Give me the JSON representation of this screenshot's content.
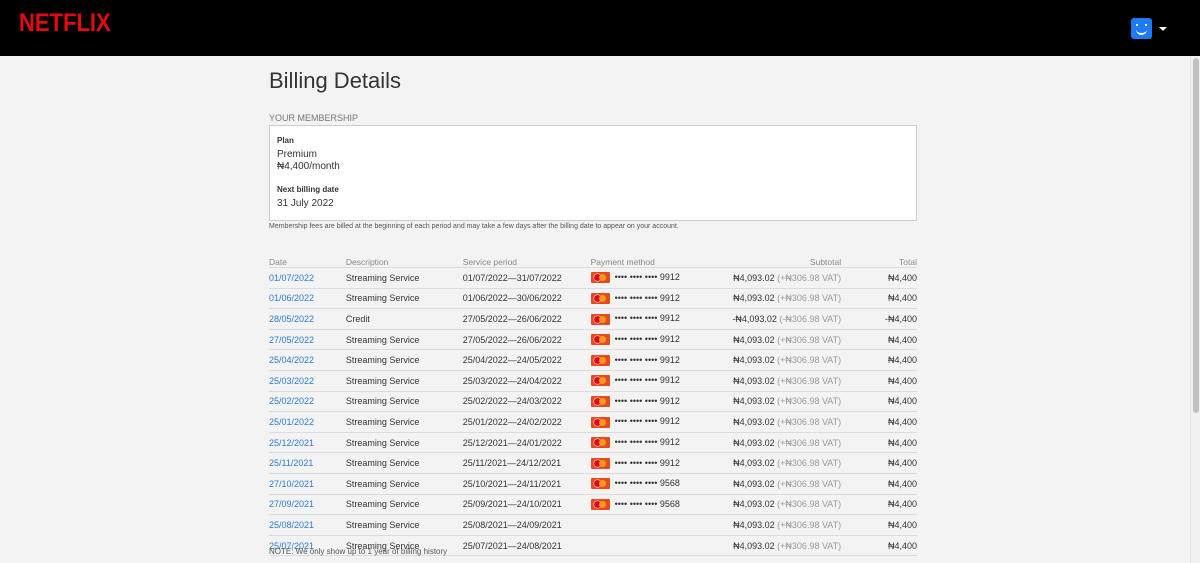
{
  "brand": {
    "logo_text": "NETFLIX",
    "logo_color": "#e50914"
  },
  "header": {
    "profile_icon": "smiley-profile-icon",
    "dropdown_icon": "caret-down-icon"
  },
  "page": {
    "title": "Billing Details"
  },
  "membership": {
    "heading": "YOUR MEMBERSHIP",
    "plan_label": "Plan",
    "plan_name": "Premium",
    "plan_price": "₦4,400/month",
    "next_billing_label": "Next billing date",
    "next_billing_date": "31 July 2022"
  },
  "fees_note": "Membership fees are billed at the beginning of each period and may take a few days after the billing date to appear on your account.",
  "table": {
    "headers": [
      "Date",
      "Description",
      "Service period",
      "Payment method",
      "Subtotal",
      "Total"
    ],
    "rows": [
      {
        "date": "01/07/2022",
        "description": "Streaming Service",
        "period": "01/07/2022—31/07/2022",
        "card": "•••• •••• •••• 9912",
        "subtotal": "₦4,093.02",
        "vat": "(+₦306.98 VAT)",
        "total": "₦4,400"
      },
      {
        "date": "01/06/2022",
        "description": "Streaming Service",
        "period": "01/06/2022—30/06/2022",
        "card": "•••• •••• •••• 9912",
        "subtotal": "₦4,093.02",
        "vat": "(+₦306.98 VAT)",
        "total": "₦4,400"
      },
      {
        "date": "28/05/2022",
        "description": "Credit",
        "period": "27/05/2022—26/06/2022",
        "card": "•••• •••• •••• 9912",
        "subtotal": "-₦4,093.02",
        "vat": "(-₦306.98 VAT)",
        "total": "-₦4,400"
      },
      {
        "date": "27/05/2022",
        "description": "Streaming Service",
        "period": "27/05/2022—26/06/2022",
        "card": "•••• •••• •••• 9912",
        "subtotal": "₦4,093.02",
        "vat": "(+₦306.98 VAT)",
        "total": "₦4,400"
      },
      {
        "date": "25/04/2022",
        "description": "Streaming Service",
        "period": "25/04/2022—24/05/2022",
        "card": "•••• •••• •••• 9912",
        "subtotal": "₦4,093.02",
        "vat": "(+₦306.98 VAT)",
        "total": "₦4,400"
      },
      {
        "date": "25/03/2022",
        "description": "Streaming Service",
        "period": "25/03/2022—24/04/2022",
        "card": "•••• •••• •••• 9912",
        "subtotal": "₦4,093.02",
        "vat": "(+₦306.98 VAT)",
        "total": "₦4,400"
      },
      {
        "date": "25/02/2022",
        "description": "Streaming Service",
        "period": "25/02/2022—24/03/2022",
        "card": "•••• •••• •••• 9912",
        "subtotal": "₦4,093.02",
        "vat": "(+₦306.98 VAT)",
        "total": "₦4,400"
      },
      {
        "date": "25/01/2022",
        "description": "Streaming Service",
        "period": "25/01/2022—24/02/2022",
        "card": "•••• •••• •••• 9912",
        "subtotal": "₦4,093.02",
        "vat": "(+₦306.98 VAT)",
        "total": "₦4,400"
      },
      {
        "date": "25/12/2021",
        "description": "Streaming Service",
        "period": "25/12/2021—24/01/2022",
        "card": "•••• •••• •••• 9912",
        "subtotal": "₦4,093.02",
        "vat": "(+₦306.98 VAT)",
        "total": "₦4,400"
      },
      {
        "date": "25/11/2021",
        "description": "Streaming Service",
        "period": "25/11/2021—24/12/2021",
        "card": "•••• •••• •••• 9912",
        "subtotal": "₦4,093.02",
        "vat": "(+₦306.98 VAT)",
        "total": "₦4,400"
      },
      {
        "date": "27/10/2021",
        "description": "Streaming Service",
        "period": "25/10/2021—24/11/2021",
        "card": "•••• •••• •••• 9568",
        "subtotal": "₦4,093.02",
        "vat": "(+₦306.98 VAT)",
        "total": "₦4,400"
      },
      {
        "date": "27/09/2021",
        "description": "Streaming Service",
        "period": "25/09/2021—24/10/2021",
        "card": "•••• •••• •••• 9568",
        "subtotal": "₦4,093.02",
        "vat": "(+₦306.98 VAT)",
        "total": "₦4,400"
      },
      {
        "date": "25/08/2021",
        "description": "Streaming Service",
        "period": "25/08/2021—24/09/2021",
        "card": "",
        "subtotal": "₦4,093.02",
        "vat": "(+₦306.98 VAT)",
        "total": "₦4,400"
      },
      {
        "date": "25/07/2021",
        "description": "Streaming Service",
        "period": "25/07/2021—24/08/2021",
        "card": "",
        "subtotal": "₦4,093.02",
        "vat": "(+₦306.98 VAT)",
        "total": "₦4,400"
      }
    ]
  },
  "footer_note": "NOTE: We only show up to 1 year of billing history",
  "colors": {
    "link": "#2b7bd1",
    "header_bg": "#000000",
    "page_bg": "#f3f3f3",
    "profile": "#1e7bf5"
  }
}
